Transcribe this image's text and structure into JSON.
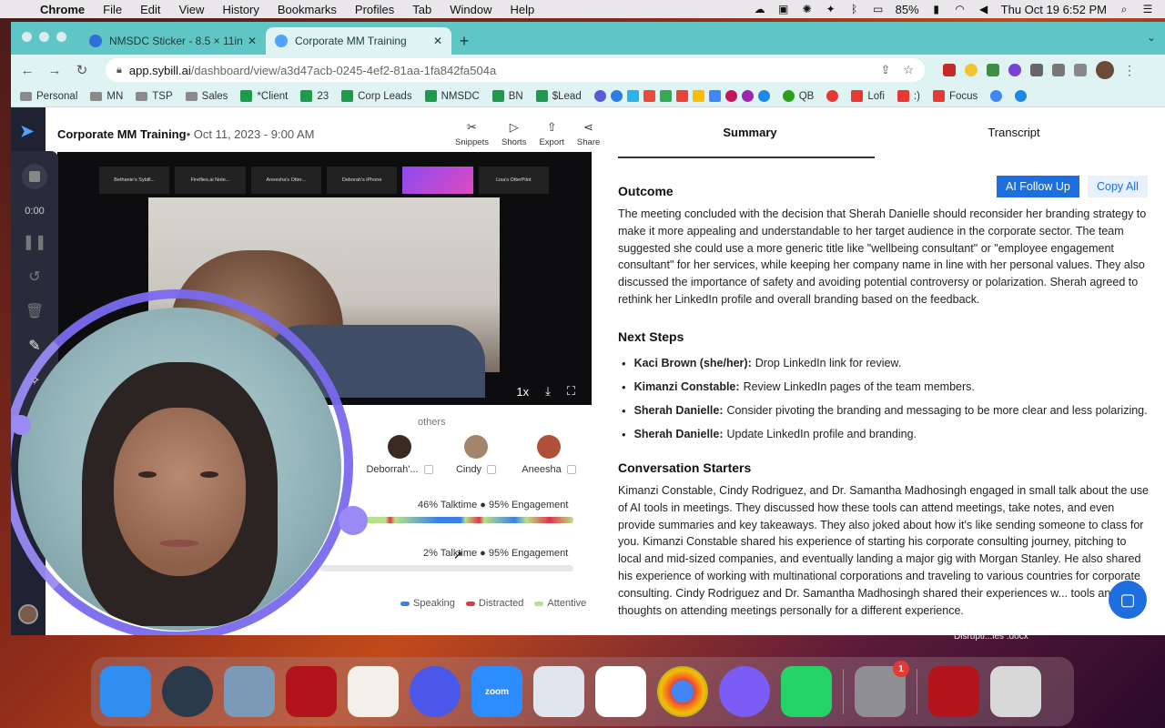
{
  "menubar": {
    "app": "Chrome",
    "items": [
      "File",
      "Edit",
      "View",
      "History",
      "Bookmarks",
      "Profiles",
      "Tab",
      "Window",
      "Help"
    ],
    "battery": "85%",
    "clock": "Thu Oct 19  6:52 PM"
  },
  "tabs": [
    {
      "title": "NMSDC Sticker - 8.5 × 11in",
      "active": false,
      "color": "#2f6fd6"
    },
    {
      "title": "Corporate MM Training",
      "active": true,
      "color": "#4da3ff"
    }
  ],
  "address": {
    "host": "app.sybill.ai",
    "path": "/dashboard/view/a3d47acb-0245-4ef2-81aa-1fa842fa504a"
  },
  "bookmarks": [
    {
      "label": "Personal",
      "kind": "folder"
    },
    {
      "label": "MN",
      "kind": "folder"
    },
    {
      "label": "TSP",
      "kind": "folder"
    },
    {
      "label": "Sales",
      "kind": "folder"
    },
    {
      "label": "*Client",
      "kind": "sheet"
    },
    {
      "label": "23",
      "kind": "sheet"
    },
    {
      "label": "Corp Leads",
      "kind": "sheet"
    },
    {
      "label": "NMSDC",
      "kind": "sheet"
    },
    {
      "label": "BN",
      "kind": "sheet"
    },
    {
      "label": "$Lead",
      "kind": "sheet"
    },
    {
      "label": "QB",
      "kind": "dot"
    },
    {
      "label": "Lofi",
      "kind": "yt"
    },
    {
      "label": ":)",
      "kind": "yt"
    },
    {
      "label": "Focus",
      "kind": "yt"
    }
  ],
  "recorder": {
    "timer": "0:00"
  },
  "meeting": {
    "title": "Corporate MM Training",
    "date": "• Oct 11, 2023 - 9:00 AM",
    "actions": [
      "Snippets",
      "Shorts",
      "Export",
      "Share"
    ]
  },
  "video": {
    "tiles": [
      "Bethanie's Sybill...",
      "Fireflies.ai Note...",
      "Aneesha's Otter...",
      "Deborah's iPhone",
      "",
      "Lisa's OtterPilot"
    ],
    "speed": "1x"
  },
  "participants": {
    "others_label": "others",
    "people": [
      {
        "name": "Deborrah'...",
        "color": "#3a2a22"
      },
      {
        "name": "Cindy",
        "color": "#a5846c"
      },
      {
        "name": "Aneesha",
        "color": "#b0503a"
      }
    ]
  },
  "stats": [
    {
      "talktime": "46% Talktime",
      "engagement": "95% Engagement",
      "talktime_pct": 46,
      "engagement_pct": 95
    },
    {
      "talktime": "2% Talktime",
      "engagement": "95% Engagement",
      "talktime_pct": 2,
      "engagement_pct": 95
    }
  ],
  "legend": [
    {
      "label": "Speaking",
      "color": "#3b82e8"
    },
    {
      "label": "Distracted",
      "color": "#e0364a"
    },
    {
      "label": "Attentive",
      "color": "#b8e08a"
    }
  ],
  "summary_tabs": [
    "Summary",
    "Transcript"
  ],
  "outcome": {
    "heading": "Outcome",
    "follow_up": "AI Follow Up",
    "copy_all": "Copy All",
    "text": "The meeting concluded with the decision that Sherah Danielle should reconsider her branding strategy to make it more appealing and understandable to her target audience in the corporate sector. The team suggested she could use a more generic title like \"wellbeing consultant\" or \"employee engagement consultant\" for her services, while keeping her company name in line with her personal values. They also discussed the importance of safety and avoiding potential controversy or polarization. Sherah agreed to rethink her LinkedIn profile and overall branding based on the feedback."
  },
  "next_steps": {
    "heading": "Next Steps",
    "items": [
      {
        "who": "Kaci Brown (she/her):",
        "what": "Drop LinkedIn link for review."
      },
      {
        "who": "Kimanzi Constable:",
        "what": "Review LinkedIn pages of the team members."
      },
      {
        "who": "Sherah Danielle:",
        "what": "Consider pivoting the branding and messaging to be more clear and less polarizing."
      },
      {
        "who": "Sherah Danielle:",
        "what": "Update LinkedIn profile and branding."
      }
    ]
  },
  "conversation": {
    "heading": "Conversation Starters",
    "text": "Kimanzi Constable, Cindy Rodriguez, and Dr. Samantha Madhosingh engaged in small talk about the use of AI tools in meetings. They discussed how these tools can attend meetings, take notes, and even provide summaries and key takeaways. They also joked about how it's like sending someone to class for you. Kimanzi Constable shared his experience of starting his corporate consulting journey, pitching to local and mid-sized companies, and eventually landing a major gig with Morgan Stanley. He also shared his experience of working with multinational corporations and traveling to various countries for corporate consulting. Cindy Rodriguez and Dr. Samantha Madhosingh shared their experiences w... tools and their thoughts on attending meetings personally for a different experience."
  },
  "desktop_file": "Disrupti...les .docx",
  "dock": {
    "icons": [
      {
        "name": "finder",
        "color": "#2f8ef0"
      },
      {
        "name": "quicktime",
        "color": "#2a3a4a"
      },
      {
        "name": "preview",
        "color": "#7a9ab8"
      },
      {
        "name": "acrobat",
        "color": "#b3141c"
      },
      {
        "name": "textedit",
        "color": "#f2f0e8"
      },
      {
        "name": "perplexity",
        "color": "#4b57e8"
      },
      {
        "name": "zoom",
        "color": "#2d8cff",
        "label": "zoom"
      },
      {
        "name": "ms-remote",
        "color": "#dfe6ef"
      },
      {
        "name": "slack",
        "color": "#ffffff"
      },
      {
        "name": "chrome",
        "color": "#f4f4f4"
      },
      {
        "name": "messenger",
        "color": "#7b5cf5"
      },
      {
        "name": "whatsapp",
        "color": "#25d366"
      },
      {
        "name": "system-settings",
        "color": "#8e8e93",
        "badge": "1"
      },
      {
        "name": "acrobat-2",
        "color": "#b3141c"
      },
      {
        "name": "trash",
        "color": "#d8d8d8"
      }
    ]
  }
}
